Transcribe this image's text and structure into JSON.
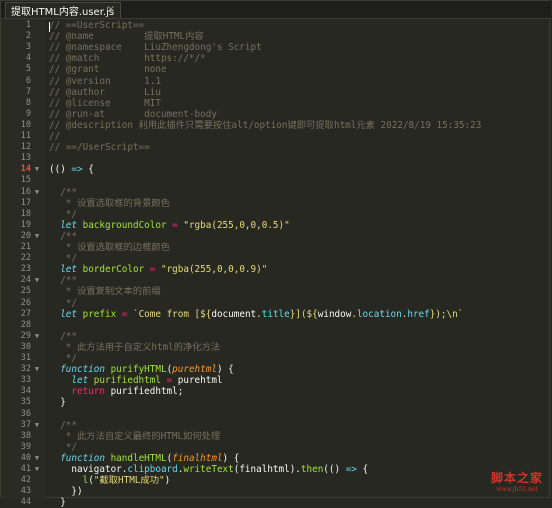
{
  "tab": {
    "title": "提取HTML内容.user.js",
    "close": "×"
  },
  "lines": [
    {
      "n": "1",
      "fold": "",
      "tokens": [
        [
          "t-cmt",
          "// ==UserScript=="
        ]
      ]
    },
    {
      "n": "2",
      "fold": "",
      "tokens": [
        [
          "t-cmt",
          "// @name         提取HTML内容"
        ]
      ]
    },
    {
      "n": "3",
      "fold": "",
      "tokens": [
        [
          "t-cmt",
          "// @namespace    LiuZhengdong's Script"
        ]
      ]
    },
    {
      "n": "4",
      "fold": "",
      "tokens": [
        [
          "t-cmt",
          "// @match        https://*/*"
        ]
      ]
    },
    {
      "n": "5",
      "fold": "",
      "tokens": [
        [
          "t-cmt",
          "// @grant        none"
        ]
      ]
    },
    {
      "n": "6",
      "fold": "",
      "tokens": [
        [
          "t-cmt",
          "// @version      1.1"
        ]
      ]
    },
    {
      "n": "7",
      "fold": "",
      "tokens": [
        [
          "t-cmt",
          "// @author       Liu"
        ]
      ]
    },
    {
      "n": "8",
      "fold": "",
      "tokens": [
        [
          "t-cmt",
          "// @license      MIT"
        ]
      ]
    },
    {
      "n": "9",
      "fold": "",
      "tokens": [
        [
          "t-cmt",
          "// @run-at       document-body"
        ]
      ]
    },
    {
      "n": "10",
      "fold": "",
      "tokens": [
        [
          "t-cmt",
          "// @description 利用此插件只需要按住alt/option键即可提取html元素 2022/8/19 15:35:23"
        ]
      ]
    },
    {
      "n": "11",
      "fold": "",
      "tokens": [
        [
          "t-cmt",
          "//"
        ]
      ]
    },
    {
      "n": "12",
      "fold": "",
      "tokens": [
        [
          "t-cmt",
          "// ==/UserScript=="
        ]
      ]
    },
    {
      "n": "13",
      "fold": "",
      "tokens": []
    },
    {
      "n": "14",
      "fold": "▼",
      "red": true,
      "tokens": [
        [
          "t-plain",
          "(() "
        ],
        [
          "t-kw2",
          "=>"
        ],
        [
          "t-plain",
          " {"
        ]
      ]
    },
    {
      "n": "15",
      "fold": "",
      "tokens": []
    },
    {
      "n": "16",
      "fold": "▼",
      "tokens": [
        [
          "t-cmt",
          "  /**"
        ]
      ]
    },
    {
      "n": "17",
      "fold": "",
      "tokens": [
        [
          "t-cmt",
          "   * 设置选取框的背景颜色"
        ]
      ]
    },
    {
      "n": "18",
      "fold": "",
      "tokens": [
        [
          "t-cmt",
          "   */"
        ]
      ]
    },
    {
      "n": "19",
      "fold": "",
      "tokens": [
        [
          "t-kw",
          "  let "
        ],
        [
          "t-var",
          "backgroundColor"
        ],
        [
          "t-op",
          " = "
        ],
        [
          "t-str",
          "\"rgba(255,0,0,0.5)\""
        ]
      ]
    },
    {
      "n": "20",
      "fold": "▼",
      "tokens": [
        [
          "t-cmt",
          "  /**"
        ]
      ]
    },
    {
      "n": "21",
      "fold": "",
      "tokens": [
        [
          "t-cmt",
          "   * 设置选取框的边框颜色"
        ]
      ]
    },
    {
      "n": "22",
      "fold": "",
      "tokens": [
        [
          "t-cmt",
          "   */"
        ]
      ]
    },
    {
      "n": "23",
      "fold": "",
      "tokens": [
        [
          "t-kw",
          "  let "
        ],
        [
          "t-var",
          "borderColor"
        ],
        [
          "t-op",
          " = "
        ],
        [
          "t-str",
          "\"rgba(255,0,0,0.9)\""
        ]
      ]
    },
    {
      "n": "24",
      "fold": "▼",
      "tokens": [
        [
          "t-cmt",
          "  /**"
        ]
      ]
    },
    {
      "n": "25",
      "fold": "",
      "tokens": [
        [
          "t-cmt",
          "   * 设置复制文本的前缀"
        ]
      ]
    },
    {
      "n": "26",
      "fold": "",
      "tokens": [
        [
          "t-cmt",
          "   */"
        ]
      ]
    },
    {
      "n": "27",
      "fold": "",
      "tokens": [
        [
          "t-kw",
          "  let "
        ],
        [
          "t-var",
          "prefix"
        ],
        [
          "t-op",
          " = "
        ],
        [
          "t-str",
          "`Come from [${"
        ],
        [
          "t-interp",
          "document"
        ],
        [
          "t-str",
          "."
        ],
        [
          "t-prop",
          "title"
        ],
        [
          "t-str",
          "}](${"
        ],
        [
          "t-interp",
          "window"
        ],
        [
          "t-str",
          "."
        ],
        [
          "t-prop",
          "location"
        ],
        [
          "t-str",
          "."
        ],
        [
          "t-prop",
          "href"
        ],
        [
          "t-str",
          "});\\n`"
        ]
      ]
    },
    {
      "n": "28",
      "fold": "",
      "tokens": []
    },
    {
      "n": "29",
      "fold": "▼",
      "tokens": [
        [
          "t-cmt",
          "  /**"
        ]
      ]
    },
    {
      "n": "30",
      "fold": "",
      "tokens": [
        [
          "t-cmt",
          "   * 此方法用于自定义html的净化方法"
        ]
      ]
    },
    {
      "n": "31",
      "fold": "",
      "tokens": [
        [
          "t-cmt",
          "   */"
        ]
      ]
    },
    {
      "n": "32",
      "fold": "▼",
      "tokens": [
        [
          "t-kw",
          "  function "
        ],
        [
          "t-fn",
          "purifyHTML"
        ],
        [
          "t-plain",
          "("
        ],
        [
          "t-param",
          "purehtml"
        ],
        [
          "t-plain",
          ") {"
        ]
      ]
    },
    {
      "n": "33",
      "fold": "",
      "tokens": [
        [
          "t-kw",
          "    let "
        ],
        [
          "t-var",
          "purifiedhtml"
        ],
        [
          "t-op",
          " = "
        ],
        [
          "t-plain",
          "purehtml"
        ]
      ]
    },
    {
      "n": "34",
      "fold": "",
      "tokens": [
        [
          "t-op",
          "    return "
        ],
        [
          "t-plain",
          "purifiedhtml;"
        ]
      ]
    },
    {
      "n": "35",
      "fold": "",
      "tokens": [
        [
          "t-plain",
          "  }"
        ]
      ]
    },
    {
      "n": "36",
      "fold": "",
      "tokens": []
    },
    {
      "n": "37",
      "fold": "▼",
      "tokens": [
        [
          "t-cmt",
          "  /**"
        ]
      ]
    },
    {
      "n": "38",
      "fold": "",
      "tokens": [
        [
          "t-cmt",
          "   * 此方法自定义最终的HTML如何处理"
        ]
      ]
    },
    {
      "n": "39",
      "fold": "",
      "tokens": [
        [
          "t-cmt",
          "   */"
        ]
      ]
    },
    {
      "n": "40",
      "fold": "▼",
      "tokens": [
        [
          "t-kw",
          "  function "
        ],
        [
          "t-fn",
          "handleHTML"
        ],
        [
          "t-plain",
          "("
        ],
        [
          "t-param",
          "finalhtml"
        ],
        [
          "t-plain",
          ") {"
        ]
      ]
    },
    {
      "n": "41",
      "fold": "▼",
      "tokens": [
        [
          "t-plain",
          "    navigator."
        ],
        [
          "t-prop",
          "clipboard"
        ],
        [
          "t-plain",
          "."
        ],
        [
          "t-fn",
          "writeText"
        ],
        [
          "t-plain",
          "(finalhtml)."
        ],
        [
          "t-fn",
          "then"
        ],
        [
          "t-plain",
          "(() "
        ],
        [
          "t-kw2",
          "=>"
        ],
        [
          "t-plain",
          " {"
        ]
      ]
    },
    {
      "n": "42",
      "fold": "",
      "tokens": [
        [
          "t-plain",
          "      "
        ],
        [
          "t-fn",
          "l"
        ],
        [
          "t-plain",
          "("
        ],
        [
          "t-str",
          "\"截取HTML成功\""
        ],
        [
          "t-plain",
          ")"
        ]
      ]
    },
    {
      "n": "43",
      "fold": "",
      "tokens": [
        [
          "t-plain",
          "    })"
        ]
      ]
    },
    {
      "n": "44",
      "fold": "",
      "tokens": [
        [
          "t-plain",
          "  }"
        ]
      ]
    }
  ],
  "watermark": {
    "main": "脚本之家",
    "sub": "www.jb51.net"
  }
}
